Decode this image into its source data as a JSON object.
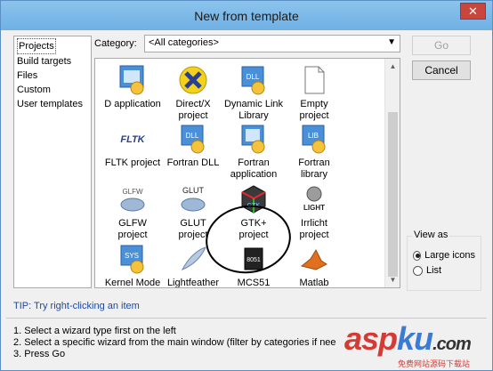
{
  "window": {
    "title": "New from template",
    "close_label": "✕"
  },
  "left_list": {
    "items": [
      {
        "label": "Projects"
      },
      {
        "label": "Build targets"
      },
      {
        "label": "Files"
      },
      {
        "label": "Custom"
      },
      {
        "label": "User templates"
      }
    ]
  },
  "category": {
    "label": "Category:",
    "value": "<All categories>"
  },
  "templates": [
    {
      "label": "D application"
    },
    {
      "label": "Direct/X\nproject"
    },
    {
      "label": "Dynamic Link\nLibrary"
    },
    {
      "label": "Empty\nproject"
    },
    {
      "label": "FLTK project"
    },
    {
      "label": "Fortran DLL"
    },
    {
      "label": "Fortran\napplication"
    },
    {
      "label": "Fortran\nlibrary"
    },
    {
      "label": "GLFW\nproject"
    },
    {
      "label": "GLUT\nproject"
    },
    {
      "label": "GTK+\nproject"
    },
    {
      "label": "Irrlicht\nproject"
    },
    {
      "label": "Kernel Mode\nDriver"
    },
    {
      "label": "Lightfeather\nproject"
    },
    {
      "label": "MCS51\nProject"
    },
    {
      "label": "Matlab\nproject"
    }
  ],
  "icon_texts": {
    "dll": "DLL",
    "lib": "LIB",
    "fltk": "FLTK",
    "glfw": "GLFW",
    "glut": "GLUT",
    "gtk": "GTK",
    "light": "LIGHT",
    "sys": "SYS",
    "mcs": "8051"
  },
  "buttons": {
    "go": "Go",
    "cancel": "Cancel"
  },
  "view_as": {
    "legend": "View as",
    "options": [
      {
        "label": "Large icons",
        "selected": true
      },
      {
        "label": "List",
        "selected": false
      }
    ]
  },
  "tip": "TIP: Try right-clicking an item",
  "instructions": [
    "1. Select a wizard type first on the left",
    "2. Select a specific wizard from the main window (filter by categories if nee",
    "3. Press Go"
  ],
  "watermark": {
    "asp": "asp",
    "ku": "ku",
    "com": ".com",
    "sub": "免费网站源码下载站"
  },
  "colors": {
    "accent": "#6fb0e4",
    "close": "#c9463d",
    "tip": "#1d48a8",
    "watermark_red": "#d43b35"
  }
}
